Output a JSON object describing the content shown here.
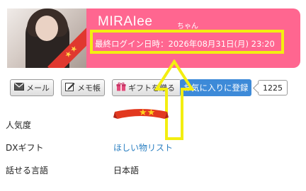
{
  "profile": {
    "name": "MIRAIee",
    "name_suffix": "ちゃん",
    "last_login": "最終ログイン日時：2026年08月31日(月) 23:20",
    "photo_ribbon": "★★",
    "header_color": "#ff6690"
  },
  "actions": {
    "mail_label": "メール",
    "memo_label": "メモ帳",
    "gift_label": "ギフトを贈る",
    "favorite_label": "お気に入りに登録",
    "favorite_count": "1225"
  },
  "info": {
    "popularity_label": "人気度",
    "popularity_stars": "★★",
    "dx_gift_label": "DXギフト",
    "dx_gift_value": "ほしい物リスト",
    "languages_label": "話せる言語",
    "languages_value": "日本語"
  },
  "icons": {
    "mail": "mail-icon",
    "memo": "memo-icon",
    "gift": "gift-icon",
    "annotation": "arrow-up-icon"
  }
}
